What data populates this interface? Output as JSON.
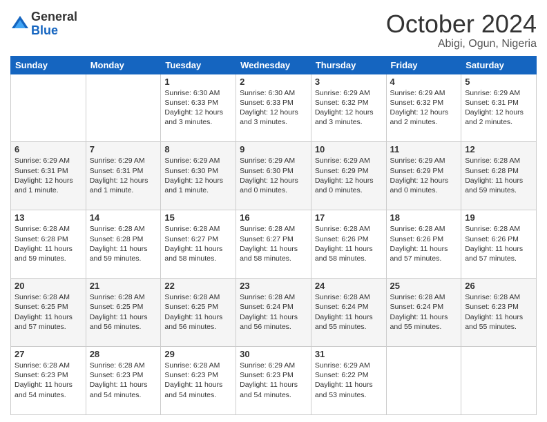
{
  "logo": {
    "general": "General",
    "blue": "Blue"
  },
  "title": "October 2024",
  "location": "Abigi, Ogun, Nigeria",
  "weekdays": [
    "Sunday",
    "Monday",
    "Tuesday",
    "Wednesday",
    "Thursday",
    "Friday",
    "Saturday"
  ],
  "weeks": [
    [
      {
        "day": "",
        "sunrise": "",
        "sunset": "",
        "daylight": ""
      },
      {
        "day": "",
        "sunrise": "",
        "sunset": "",
        "daylight": ""
      },
      {
        "day": "1",
        "sunrise": "Sunrise: 6:30 AM",
        "sunset": "Sunset: 6:33 PM",
        "daylight": "Daylight: 12 hours and 3 minutes."
      },
      {
        "day": "2",
        "sunrise": "Sunrise: 6:30 AM",
        "sunset": "Sunset: 6:33 PM",
        "daylight": "Daylight: 12 hours and 3 minutes."
      },
      {
        "day": "3",
        "sunrise": "Sunrise: 6:29 AM",
        "sunset": "Sunset: 6:32 PM",
        "daylight": "Daylight: 12 hours and 3 minutes."
      },
      {
        "day": "4",
        "sunrise": "Sunrise: 6:29 AM",
        "sunset": "Sunset: 6:32 PM",
        "daylight": "Daylight: 12 hours and 2 minutes."
      },
      {
        "day": "5",
        "sunrise": "Sunrise: 6:29 AM",
        "sunset": "Sunset: 6:31 PM",
        "daylight": "Daylight: 12 hours and 2 minutes."
      }
    ],
    [
      {
        "day": "6",
        "sunrise": "Sunrise: 6:29 AM",
        "sunset": "Sunset: 6:31 PM",
        "daylight": "Daylight: 12 hours and 1 minute."
      },
      {
        "day": "7",
        "sunrise": "Sunrise: 6:29 AM",
        "sunset": "Sunset: 6:31 PM",
        "daylight": "Daylight: 12 hours and 1 minute."
      },
      {
        "day": "8",
        "sunrise": "Sunrise: 6:29 AM",
        "sunset": "Sunset: 6:30 PM",
        "daylight": "Daylight: 12 hours and 1 minute."
      },
      {
        "day": "9",
        "sunrise": "Sunrise: 6:29 AM",
        "sunset": "Sunset: 6:30 PM",
        "daylight": "Daylight: 12 hours and 0 minutes."
      },
      {
        "day": "10",
        "sunrise": "Sunrise: 6:29 AM",
        "sunset": "Sunset: 6:29 PM",
        "daylight": "Daylight: 12 hours and 0 minutes."
      },
      {
        "day": "11",
        "sunrise": "Sunrise: 6:29 AM",
        "sunset": "Sunset: 6:29 PM",
        "daylight": "Daylight: 12 hours and 0 minutes."
      },
      {
        "day": "12",
        "sunrise": "Sunrise: 6:28 AM",
        "sunset": "Sunset: 6:28 PM",
        "daylight": "Daylight: 11 hours and 59 minutes."
      }
    ],
    [
      {
        "day": "13",
        "sunrise": "Sunrise: 6:28 AM",
        "sunset": "Sunset: 6:28 PM",
        "daylight": "Daylight: 11 hours and 59 minutes."
      },
      {
        "day": "14",
        "sunrise": "Sunrise: 6:28 AM",
        "sunset": "Sunset: 6:28 PM",
        "daylight": "Daylight: 11 hours and 59 minutes."
      },
      {
        "day": "15",
        "sunrise": "Sunrise: 6:28 AM",
        "sunset": "Sunset: 6:27 PM",
        "daylight": "Daylight: 11 hours and 58 minutes."
      },
      {
        "day": "16",
        "sunrise": "Sunrise: 6:28 AM",
        "sunset": "Sunset: 6:27 PM",
        "daylight": "Daylight: 11 hours and 58 minutes."
      },
      {
        "day": "17",
        "sunrise": "Sunrise: 6:28 AM",
        "sunset": "Sunset: 6:26 PM",
        "daylight": "Daylight: 11 hours and 58 minutes."
      },
      {
        "day": "18",
        "sunrise": "Sunrise: 6:28 AM",
        "sunset": "Sunset: 6:26 PM",
        "daylight": "Daylight: 11 hours and 57 minutes."
      },
      {
        "day": "19",
        "sunrise": "Sunrise: 6:28 AM",
        "sunset": "Sunset: 6:26 PM",
        "daylight": "Daylight: 11 hours and 57 minutes."
      }
    ],
    [
      {
        "day": "20",
        "sunrise": "Sunrise: 6:28 AM",
        "sunset": "Sunset: 6:25 PM",
        "daylight": "Daylight: 11 hours and 57 minutes."
      },
      {
        "day": "21",
        "sunrise": "Sunrise: 6:28 AM",
        "sunset": "Sunset: 6:25 PM",
        "daylight": "Daylight: 11 hours and 56 minutes."
      },
      {
        "day": "22",
        "sunrise": "Sunrise: 6:28 AM",
        "sunset": "Sunset: 6:25 PM",
        "daylight": "Daylight: 11 hours and 56 minutes."
      },
      {
        "day": "23",
        "sunrise": "Sunrise: 6:28 AM",
        "sunset": "Sunset: 6:24 PM",
        "daylight": "Daylight: 11 hours and 56 minutes."
      },
      {
        "day": "24",
        "sunrise": "Sunrise: 6:28 AM",
        "sunset": "Sunset: 6:24 PM",
        "daylight": "Daylight: 11 hours and 55 minutes."
      },
      {
        "day": "25",
        "sunrise": "Sunrise: 6:28 AM",
        "sunset": "Sunset: 6:24 PM",
        "daylight": "Daylight: 11 hours and 55 minutes."
      },
      {
        "day": "26",
        "sunrise": "Sunrise: 6:28 AM",
        "sunset": "Sunset: 6:23 PM",
        "daylight": "Daylight: 11 hours and 55 minutes."
      }
    ],
    [
      {
        "day": "27",
        "sunrise": "Sunrise: 6:28 AM",
        "sunset": "Sunset: 6:23 PM",
        "daylight": "Daylight: 11 hours and 54 minutes."
      },
      {
        "day": "28",
        "sunrise": "Sunrise: 6:28 AM",
        "sunset": "Sunset: 6:23 PM",
        "daylight": "Daylight: 11 hours and 54 minutes."
      },
      {
        "day": "29",
        "sunrise": "Sunrise: 6:28 AM",
        "sunset": "Sunset: 6:23 PM",
        "daylight": "Daylight: 11 hours and 54 minutes."
      },
      {
        "day": "30",
        "sunrise": "Sunrise: 6:29 AM",
        "sunset": "Sunset: 6:23 PM",
        "daylight": "Daylight: 11 hours and 54 minutes."
      },
      {
        "day": "31",
        "sunrise": "Sunrise: 6:29 AM",
        "sunset": "Sunset: 6:22 PM",
        "daylight": "Daylight: 11 hours and 53 minutes."
      },
      {
        "day": "",
        "sunrise": "",
        "sunset": "",
        "daylight": ""
      },
      {
        "day": "",
        "sunrise": "",
        "sunset": "",
        "daylight": ""
      }
    ]
  ]
}
